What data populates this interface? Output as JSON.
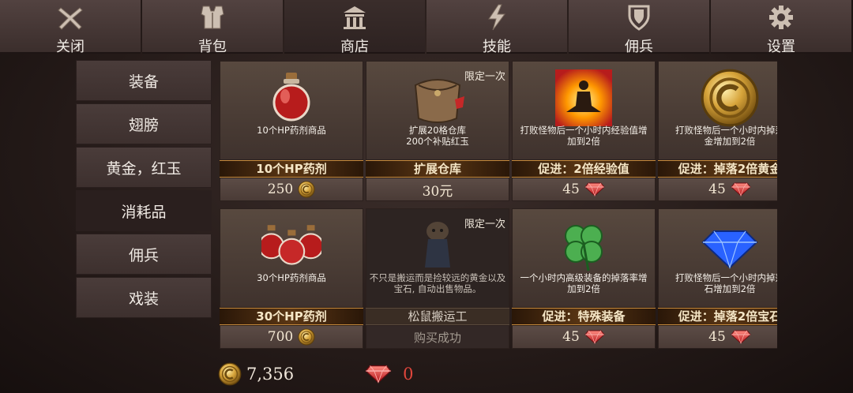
{
  "tabs": [
    {
      "label": "关闭",
      "icon": "close-icon"
    },
    {
      "label": "背包",
      "icon": "armor-icon"
    },
    {
      "label": "商店",
      "icon": "shop-icon",
      "active": true
    },
    {
      "label": "技能",
      "icon": "lightning-icon"
    },
    {
      "label": "佣兵",
      "icon": "shield-icon"
    },
    {
      "label": "设置",
      "icon": "gear-icon"
    }
  ],
  "menu": [
    "装备",
    "翅膀",
    "黄金，红玉",
    "消耗品",
    "佣兵",
    "戏装"
  ],
  "menu_active": "消耗品",
  "items": [
    {
      "desc": "10个HP药剂商品",
      "name": "10个HP药剂",
      "price": "250",
      "currency": "gold",
      "icon": "potion-icon"
    },
    {
      "desc": "扩展20格仓库\n200个补贴红玉",
      "name": "扩展仓库",
      "price": "30元",
      "currency": "cash",
      "limit": "限定一次",
      "icon": "bag-icon"
    },
    {
      "desc": "打败怪物后一个小时内经验值增\n加到2倍",
      "name": "促进：2倍经验值",
      "price": "45",
      "currency": "ruby",
      "icon": "meditation-icon"
    },
    {
      "desc": "打败怪物后一个小时内掉落\n金增加到2倍",
      "name": "促进：掉落2倍黄金",
      "price": "45",
      "currency": "ruby",
      "icon": "gold-coin-icon"
    },
    {
      "desc": "30个HP药剂商品",
      "name": "30个HP药剂",
      "price": "700",
      "currency": "gold",
      "icon": "potions-icon"
    },
    {
      "desc": "不只是搬运而是捡较远的黄金以及\n宝石, 自动出售物品。",
      "name": "松鼠搬运工",
      "price": "购买成功",
      "currency": "none",
      "limit": "限定一次",
      "icon": "squirrel-icon",
      "purchased": true
    },
    {
      "desc": "一个小时内高级装备的掉落率增\n加到2倍",
      "name": "促进：特殊装备",
      "price": "45",
      "currency": "ruby",
      "icon": "clover-icon"
    },
    {
      "desc": "打败怪物后一个小时内掉落\n石增加到2倍",
      "name": "促进：掉落2倍宝石",
      "price": "45",
      "currency": "ruby",
      "icon": "diamond-icon"
    }
  ],
  "wallet": {
    "gold": "7,356",
    "ruby": "0"
  },
  "colors": {
    "accent_gold": "#c68a3c",
    "ruby": "#e0463c"
  }
}
